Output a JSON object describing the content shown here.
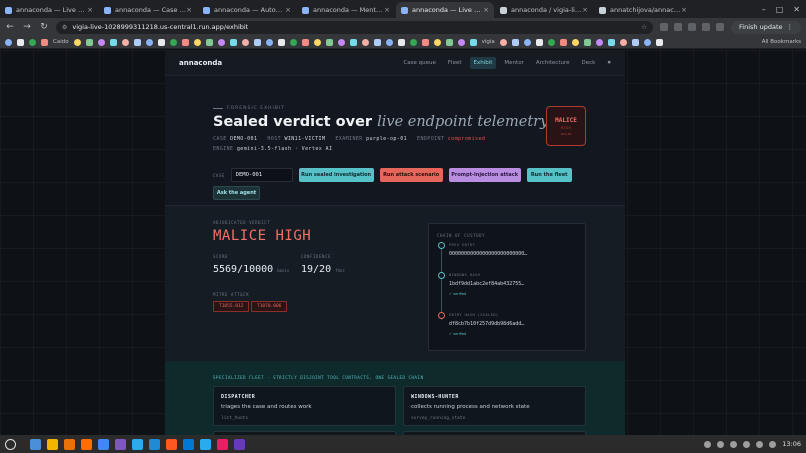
{
  "browser": {
    "tabs": [
      {
        "title": "annaconda — Live Purple Te…",
        "color": "#8ab4f8",
        "active": false
      },
      {
        "title": "annaconda — Case Queue",
        "color": "#8ab4f8",
        "active": false
      },
      {
        "title": "annaconda — Autonomous I…",
        "color": "#8ab4f8",
        "active": false
      },
      {
        "title": "annaconda — Mentor Conso…",
        "color": "#8ab4f8",
        "active": false
      },
      {
        "title": "annaconda — Live Purple Te…",
        "color": "#8ab4f8",
        "active": true
      },
      {
        "title": "annaconda / vigia-live — sp…",
        "color": "#c9d1d9",
        "active": false
      },
      {
        "title": "annatchijova/annaconda: Li…",
        "color": "#c9d1d9",
        "active": false
      }
    ],
    "url": "vigia-live-1028999311218.us-central1.run.app/exhibit",
    "update_label": "Finish update",
    "bookmarks": [
      "Caido",
      "vigia"
    ],
    "all_bookmarks": "All Bookmarks"
  },
  "site": {
    "logo": "annaconda",
    "nav": [
      "Case queue",
      "Fleet",
      "Exhibit",
      "Mentor",
      "Architecture",
      "Deck"
    ],
    "nav_active": 2,
    "nav_more": "»"
  },
  "hero": {
    "eyebrow": "FORENSIC EXHIBIT",
    "title_main": "Sealed verdict over ",
    "title_em": "live endpoint telemetry",
    "meta1": [
      {
        "k": "CASE",
        "v": "DEMO-001",
        "red": false
      },
      {
        "k": "HOST",
        "v": "WIN11-VICTIM",
        "red": false
      },
      {
        "k": "EXAMINER",
        "v": "purple-op-01",
        "red": false
      },
      {
        "k": "ENDPOINT",
        "v": "compromised",
        "red": true
      }
    ],
    "meta2": [
      {
        "k": "ENGINE",
        "v": "gemini-3.5-flash · Vertex AI"
      }
    ],
    "seal": {
      "line1": "MALICE",
      "line2": "HIGH",
      "line3": "SEALED"
    },
    "case_label": "CASE",
    "case_value": "DEMO-001",
    "buttons": {
      "run_sealed": "Run sealed investigation",
      "run_attack": "Run attack scenario",
      "prompt_injection": "Prompt-injection attack",
      "run_fleet": "Run the fleet",
      "ask_agent": "Ask the agent"
    }
  },
  "verdict": {
    "label": "ADJUDICATED VERDICT",
    "value": "MALICE HIGH",
    "score_label": "SCORE",
    "score_value": "5569/10000",
    "score_unit": "basis",
    "confidence_label": "CONFIDENCE",
    "confidence_value": "19/20",
    "confidence_unit": "fdsc",
    "mitre_label": "MITRE ATT&CK",
    "mitre": [
      "T1055.012",
      "T1070.006"
    ]
  },
  "custody": {
    "label": "CHAIN OF CUSTODY",
    "entries": [
      {
        "tag": "PREV ENTRY",
        "hash": "0000000000000000000000000…",
        "verified": ""
      },
      {
        "tag": "WINDOWS HASH",
        "hash": "1bdf9dd1abc2ef84ab432755…",
        "verified": "✓ verified"
      },
      {
        "tag": "ENTRY HASH (SEALED)",
        "hash": "df8cb7b10f257d9db98d6add…",
        "verified": "✓ verified"
      }
    ]
  },
  "fleet": {
    "label": "SPECIALIZED FLEET · STRICTLY DISJOINT TOOL CONTRACTS, ONE SEALED CHAIN",
    "cards": [
      {
        "name": "DISPATCHER",
        "desc": "triages the case and routes work",
        "tool": "list_hunts"
      },
      {
        "name": "WINDOWS-HUNTER",
        "desc": "collects running process and network state",
        "tool": "survey_running_state"
      }
    ]
  },
  "taskbar": {
    "time": "13:06"
  }
}
